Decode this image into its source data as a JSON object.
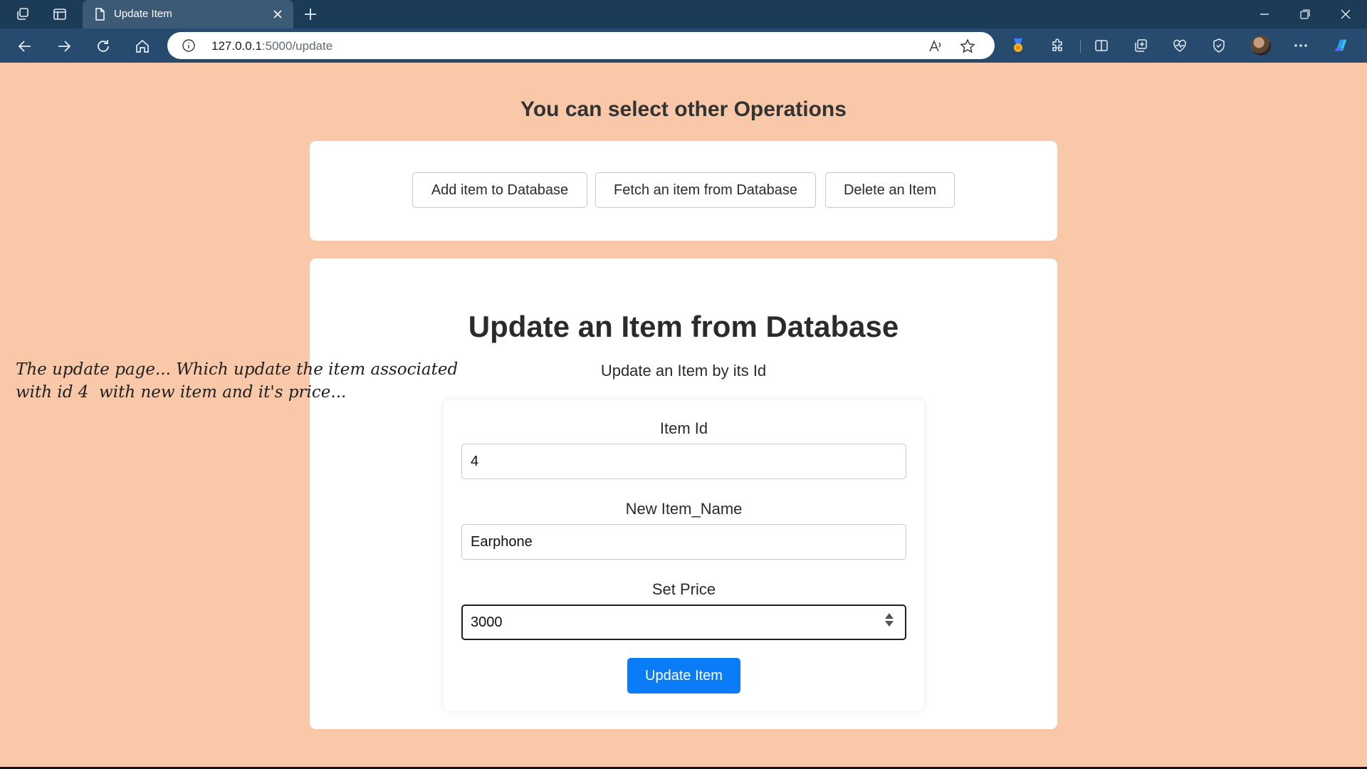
{
  "browser": {
    "tab_title": "Update Item",
    "url_host": "127.0.0.1",
    "url_path": ":5000/update",
    "accent_color": "#264b6e",
    "icons": [
      "workspaces-icon",
      "tab-actions-icon",
      "page-icon",
      "close-icon",
      "plus-icon",
      "minimize-icon",
      "restore-icon",
      "back-icon",
      "forward-icon",
      "refresh-icon",
      "home-icon",
      "info-icon",
      "read-aloud-icon",
      "favorite-star-icon",
      "rewards-icon",
      "extensions-icon",
      "split-screen-icon",
      "collections-icon",
      "health-icon",
      "browser-essentials-icon",
      "profile-avatar",
      "more-icon",
      "copilot-icon"
    ]
  },
  "ops": {
    "heading": "You can select other Operations",
    "buttons": [
      "Add item to Database",
      "Fetch an item from Database",
      "Delete an Item"
    ]
  },
  "update": {
    "title": "Update an Item from Database",
    "subtitle": "Update an Item by its Id",
    "fields": {
      "item_id": {
        "label": "Item Id",
        "value": "4"
      },
      "item_name": {
        "label": "New Item_Name",
        "value": "Earphone"
      },
      "price": {
        "label": "Set Price",
        "value": "3000"
      }
    },
    "submit_label": "Update Item",
    "submit_color": "#0a7cf8"
  },
  "annotation": {
    "line1": "The update page... Which update the item associated",
    "line2": "with id 4  with new item and it's price..."
  },
  "page_background": "#f8c8a8"
}
